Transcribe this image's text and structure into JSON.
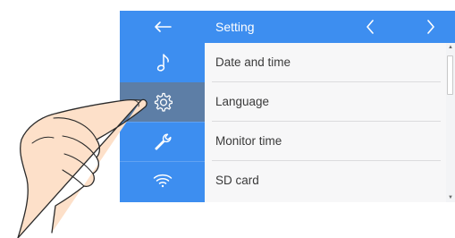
{
  "header": {
    "title": "Setting",
    "back_icon": "arrow-left-icon",
    "prev_icon": "chevron-left-icon",
    "next_icon": "chevron-right-icon"
  },
  "sidebar": {
    "items": [
      {
        "icon": "music-note-icon",
        "active": false
      },
      {
        "icon": "gear-icon",
        "active": true
      },
      {
        "icon": "wrench-icon",
        "active": false
      },
      {
        "icon": "wifi-icon",
        "active": false
      }
    ]
  },
  "settings_list": {
    "items": [
      {
        "label": "Date and time"
      },
      {
        "label": "Language"
      },
      {
        "label": "Monitor time"
      },
      {
        "label": "SD card"
      }
    ]
  },
  "colors": {
    "header_blue": "#3d8ef0",
    "active_item": "#5d7ea6",
    "list_bg": "#f7f7f8"
  }
}
